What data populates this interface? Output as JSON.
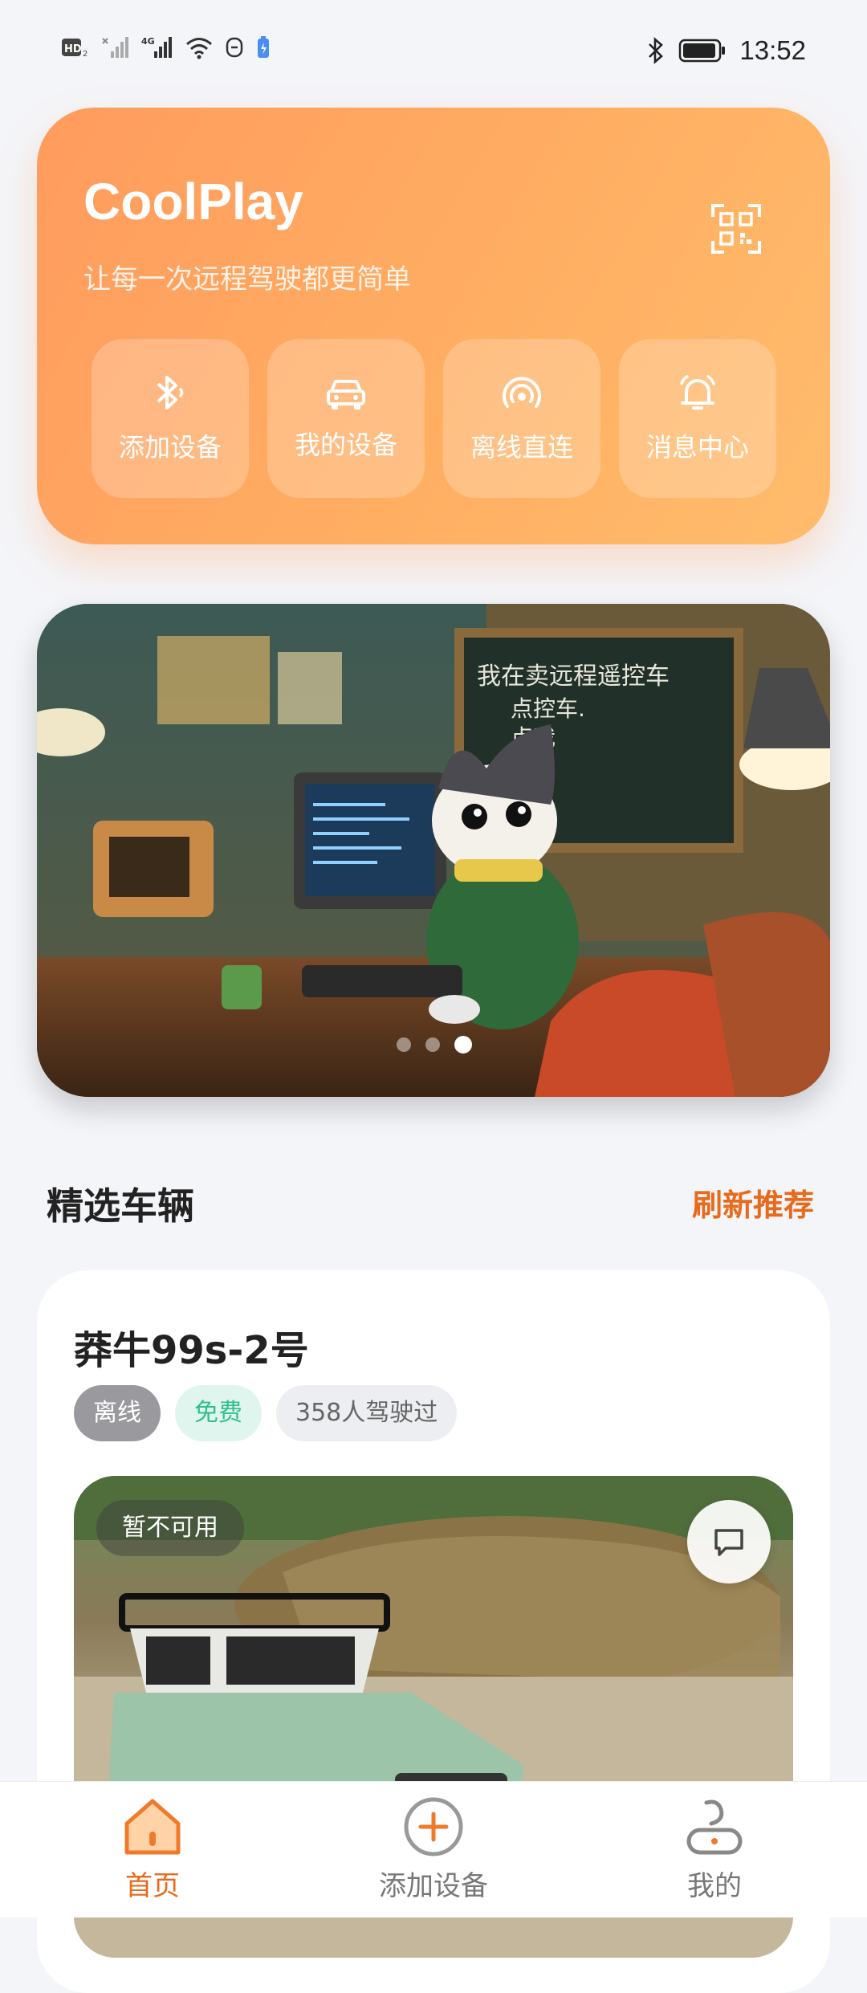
{
  "status_bar": {
    "time": "13:52",
    "left_icons": [
      "hd-icon",
      "signal-icon",
      "4g-signal-icon",
      "wifi-icon",
      "nfc-icon",
      "battery-saver-icon"
    ],
    "right_icons": [
      "bluetooth-icon",
      "battery-icon"
    ]
  },
  "hero": {
    "title": "CoolPlay",
    "subtitle": "让每一次远程驾驶都更简单",
    "actions": [
      {
        "label": "添加设备",
        "icon": "bluetooth-icon"
      },
      {
        "label": "我的设备",
        "icon": "car-icon"
      },
      {
        "label": "离线直连",
        "icon": "wireless-icon"
      },
      {
        "label": "消息中心",
        "icon": "bell-icon"
      }
    ]
  },
  "banner": {
    "chalkboard_text": "我在卖远程遥控车 点控车 点我",
    "active_slide": 3,
    "slide_count": 3
  },
  "featured": {
    "title": "精选车辆",
    "refresh_label": "刷新推荐"
  },
  "vehicle": {
    "name": "莽牛99s-2号",
    "tags": {
      "status": "离线",
      "price": "免费",
      "drivers": "358人驾驶过"
    },
    "unavailable_label": "暂不可用"
  },
  "tabbar": {
    "items": [
      {
        "label": "首页",
        "icon": "home-icon",
        "active": true
      },
      {
        "label": "添加设备",
        "icon": "add-circle-icon",
        "active": false
      },
      {
        "label": "我的",
        "icon": "profile-icon",
        "active": false
      }
    ]
  },
  "colors": {
    "accent": "#e86a1c",
    "hero_start": "#ff9b5e",
    "hero_end": "#ffbc6c",
    "free_tag": "#2fbf8f"
  }
}
